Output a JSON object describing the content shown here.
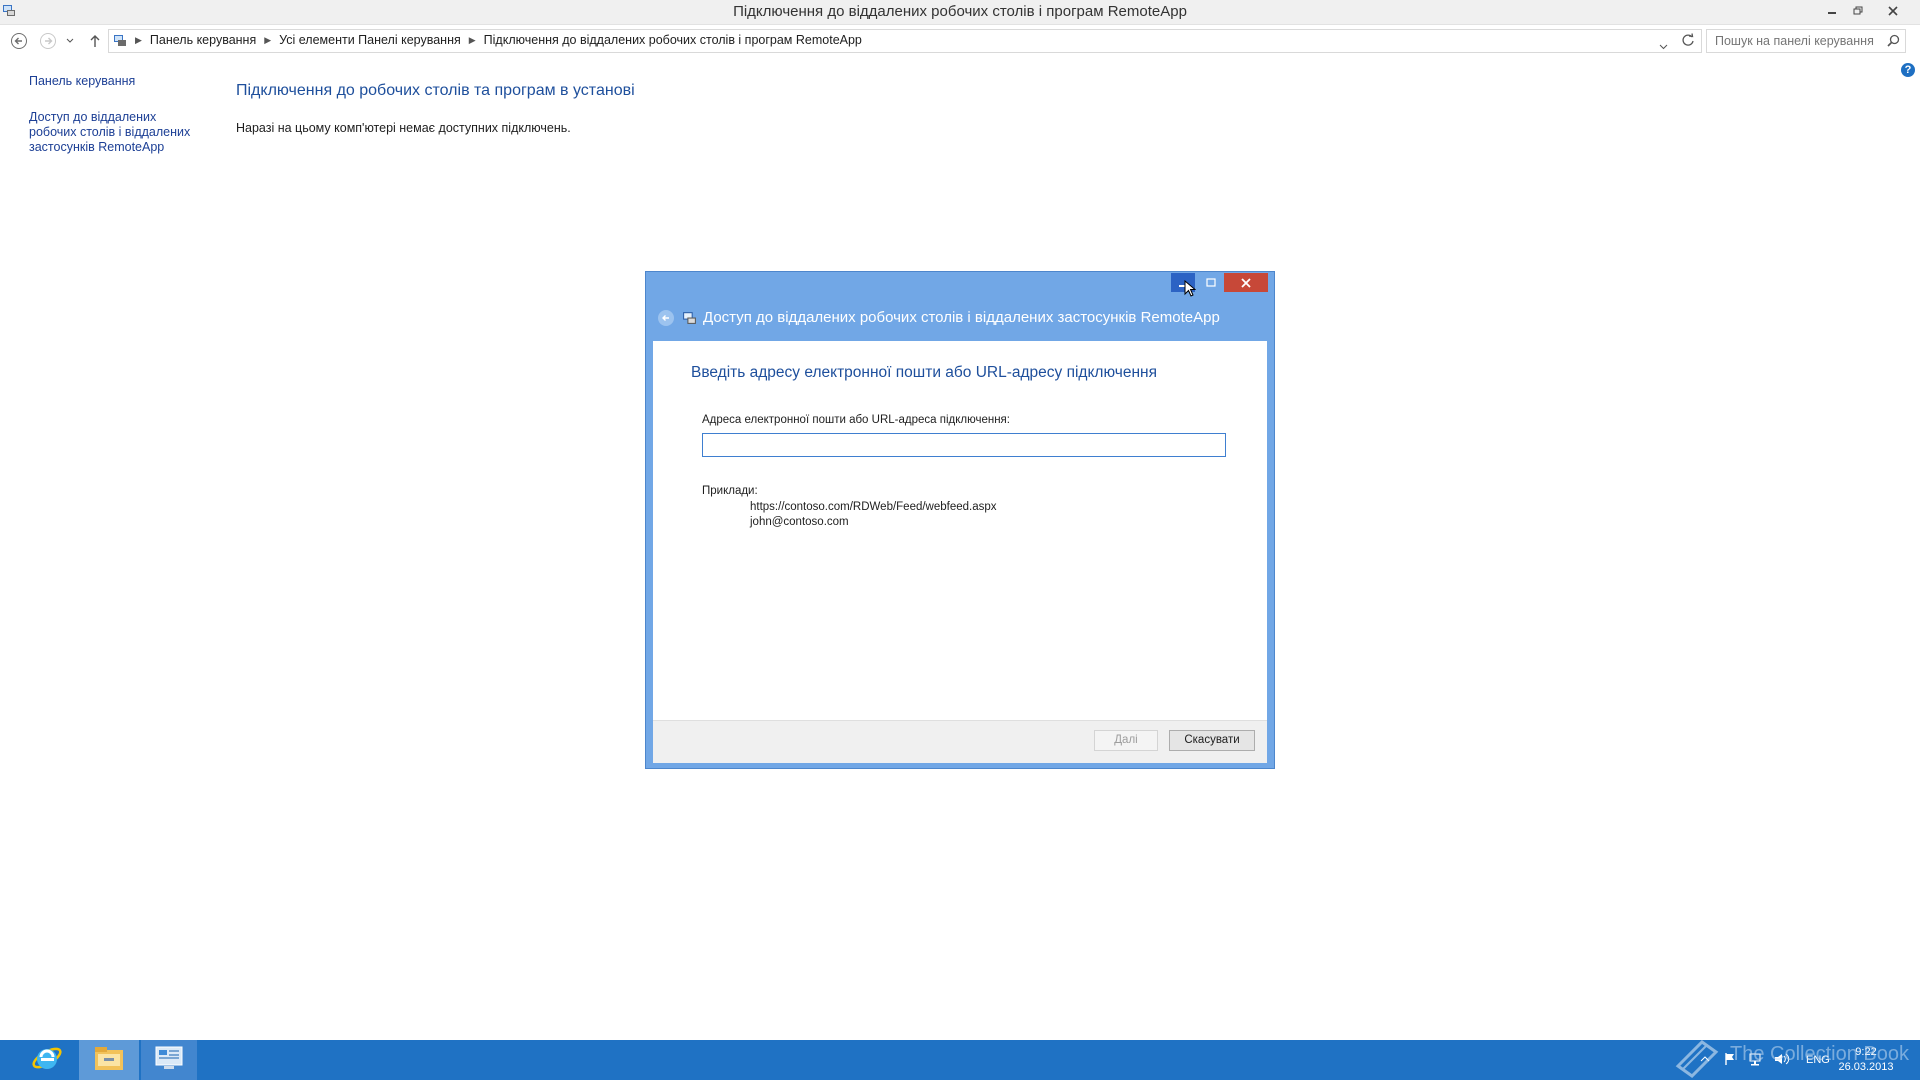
{
  "window": {
    "title": "Підключення до віддалених робочих столів і програм RemoteApp"
  },
  "address_bar": {
    "breadcrumbs": [
      "Панель керування",
      "Усі елементи Панелі керування",
      "Підключення до віддалених робочих столів і програм RemoteApp"
    ],
    "search_placeholder": "Пошук на панелі керування"
  },
  "left_pane": {
    "home_link": "Панель керування",
    "access_link": "Доступ до віддалених робочих столів і віддалених застосунків RemoteApp"
  },
  "content": {
    "title": "Підключення до робочих столів та програм в установі",
    "message": "Наразі на цьому комп'ютері немає доступних підключень."
  },
  "dialog": {
    "title": "Доступ до віддалених робочих столів і віддалених застосунків RemoteApp",
    "heading": "Введіть адресу електронної пошти або URL-адресу підключення",
    "field_label": "Адреса електронної пошти або URL-адреса підключення:",
    "field_value": "",
    "examples_label": "Приклади:",
    "examples": [
      "https://contoso.com/RDWeb/Feed/webfeed.aspx",
      "john@contoso.com"
    ],
    "next_button": "Далі",
    "cancel_button": "Скасувати"
  },
  "taskbar": {
    "items": [
      "internet-explorer-icon",
      "file-explorer-icon",
      "control-panel-icon"
    ],
    "language": "ENG",
    "time": "9:22",
    "date": "26.03.2013"
  },
  "watermark": {
    "text": "The Collection Book"
  },
  "colors": {
    "dialog_frame": "#71a7e6",
    "taskbar": "#1f72c4",
    "link": "#1c3f95",
    "heading": "#1e4f9c",
    "close_button": "#c74838"
  }
}
